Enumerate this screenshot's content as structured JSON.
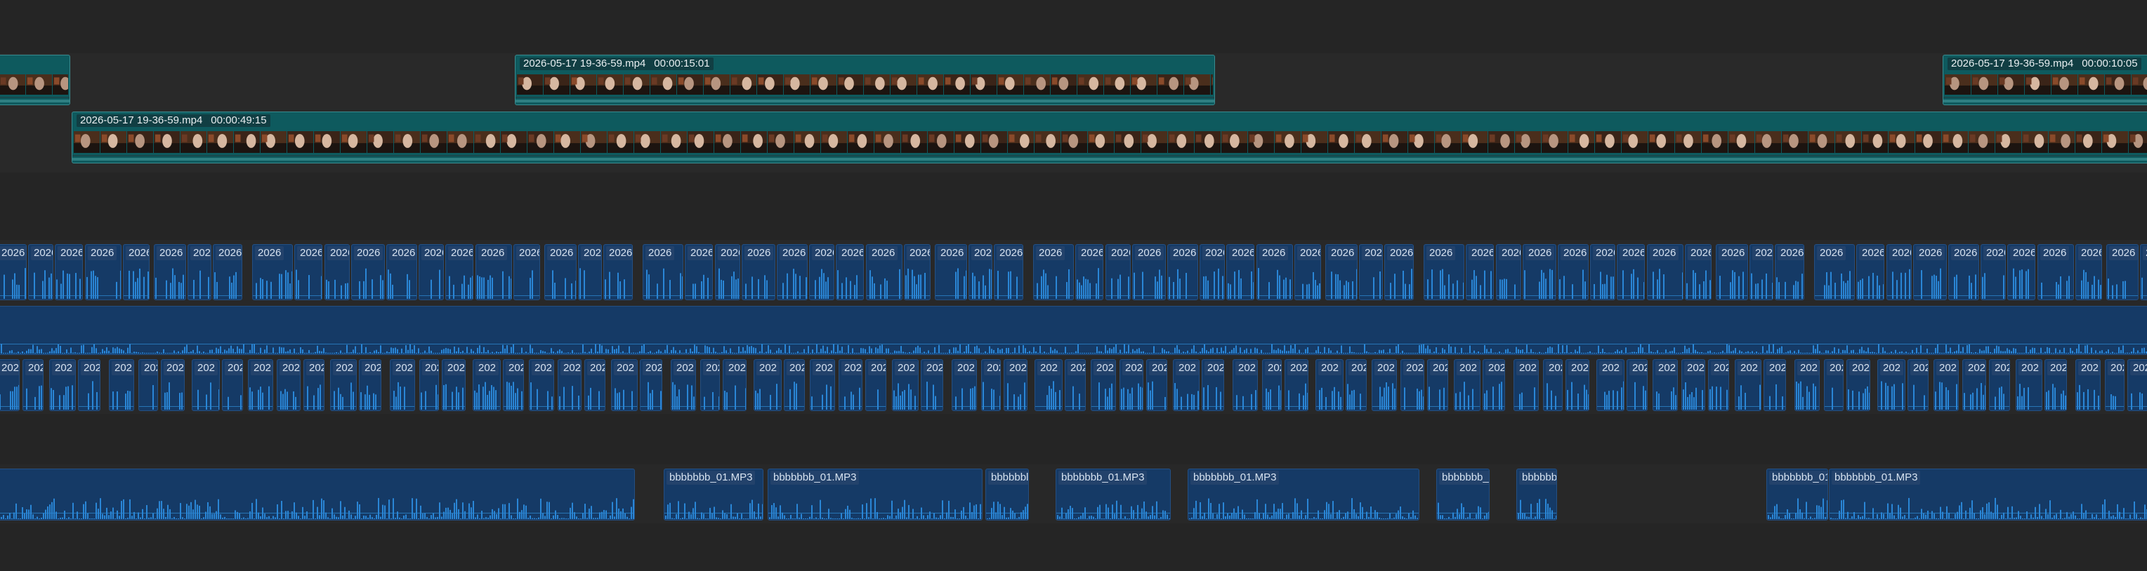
{
  "colors": {
    "background": "#252525",
    "lane": "#292929",
    "video_clip": "#0e5a5e",
    "audio_clip": "#153a66",
    "waveform": "#2a86d6"
  },
  "video_tracks": [
    {
      "id": "v2",
      "clips": [
        {
          "id": "v2c1",
          "label": "",
          "duration": ""
        },
        {
          "id": "v2c2",
          "label": "2026-05-17 19-36-59.mp4",
          "duration": "00:00:15:01"
        },
        {
          "id": "v2c3",
          "label": "2026-05-17 19-36-59.mp4",
          "duration": "00:00:10:05"
        }
      ]
    },
    {
      "id": "v1",
      "clips": [
        {
          "id": "v1c1",
          "label": "2026-05-17 19-36-59.mp4",
          "duration": "00:00:49:15"
        }
      ]
    }
  ],
  "audio_tracks": [
    {
      "id": "a1",
      "clip_label": "2026"
    },
    {
      "id": "a2",
      "clip_label": ""
    },
    {
      "id": "a3",
      "clip_label": "202"
    },
    {
      "id": "a4",
      "clips": [
        {
          "id": "a4c1",
          "label": ""
        },
        {
          "id": "a4c2",
          "label": "bbbbbbb_01.MP3"
        },
        {
          "id": "a4c3",
          "label": "bbbbbbb_01.MP3"
        },
        {
          "id": "a4c4",
          "label": "bbbbbbl"
        },
        {
          "id": "a4c5",
          "label": "bbbbbbb_01.MP3"
        },
        {
          "id": "a4c6",
          "label": "bbbbbbb_01.MP3"
        },
        {
          "id": "a4c7",
          "label": "bbbbbbb_"
        },
        {
          "id": "a4c8",
          "label": "bbbbbb"
        },
        {
          "id": "a4c9",
          "label": "bbbbbbb_01"
        },
        {
          "id": "a4c10",
          "label": "bbbbbbb_01.MP3"
        }
      ]
    }
  ]
}
